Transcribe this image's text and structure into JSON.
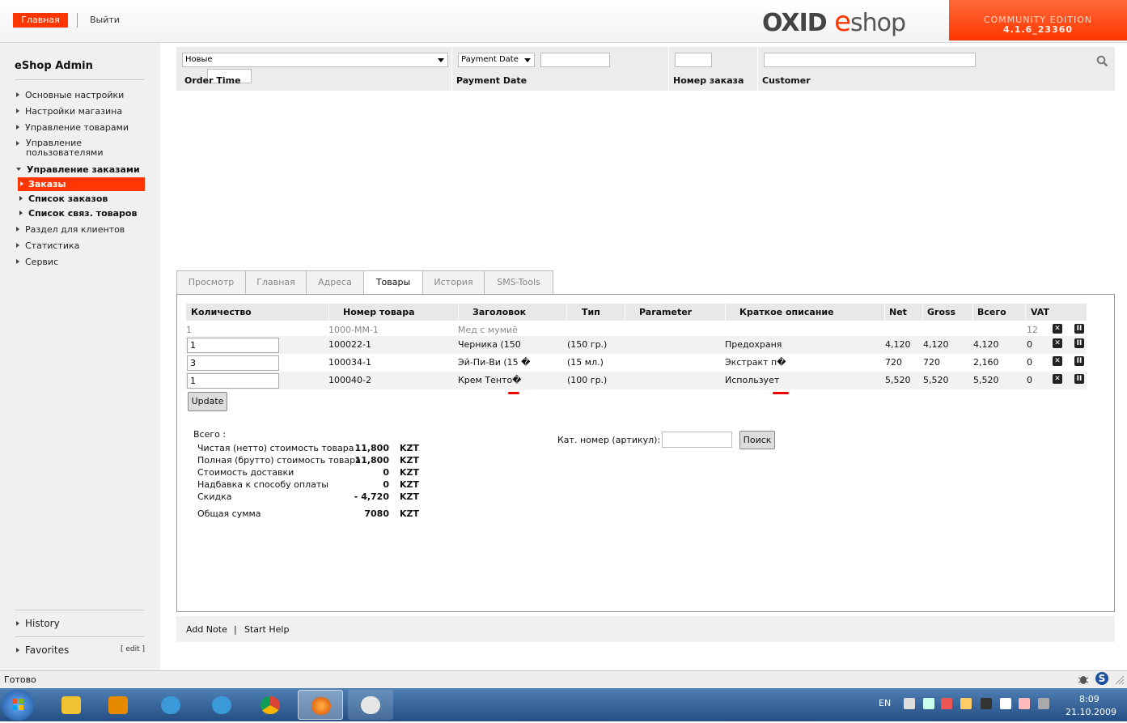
{
  "header": {
    "home_label": "Главная",
    "logout_label": "Выйти",
    "logo_oxid": "OXID",
    "logo_e": "e",
    "logo_shop": "shop",
    "edition_line1": "COMMUNITY EDITION",
    "edition_line2": "4.1.6_23360"
  },
  "sidebar": {
    "title": "eShop Admin",
    "items": [
      {
        "label": "Основные настройки"
      },
      {
        "label": "Настройки магазина"
      },
      {
        "label": "Управление товарами"
      },
      {
        "label": "Управление пользователями"
      },
      {
        "label": "Управление заказами"
      },
      {
        "label": "Раздел для клиентов"
      },
      {
        "label": "Статистика"
      },
      {
        "label": "Сервис"
      }
    ],
    "subitems": [
      {
        "label": "Заказы"
      },
      {
        "label": "Список заказов"
      },
      {
        "label": "Список связ. товаров"
      }
    ],
    "history_label": "History",
    "favorites_label": "Favorites",
    "edit_label": "[ edit ]"
  },
  "filter": {
    "status_value": "Новые",
    "order_time_label": "Order Time",
    "payment_select_value": "Payment Date",
    "payment_date_label": "Payment Date",
    "order_number_label": "Номер заказа",
    "customer_label": "Customer"
  },
  "tabs": [
    {
      "label": "Просмотр"
    },
    {
      "label": "Главная"
    },
    {
      "label": "Адреса"
    },
    {
      "label": "Товары"
    },
    {
      "label": "История"
    },
    {
      "label": "SMS-Tools"
    }
  ],
  "table": {
    "headers": [
      "Количество",
      "Номер товара",
      "Заголовок",
      "Тип",
      "Parameter",
      "Краткое описание",
      "Net",
      "Gross",
      "Всего",
      "VAT"
    ],
    "rows": [
      {
        "qty": "1",
        "number": "1000-MM-1",
        "title": "Мед с мумиё",
        "type": "",
        "param": "",
        "desc": "",
        "net": "",
        "gross": "",
        "total": "",
        "vat": "12"
      },
      {
        "qty": "1",
        "number": "100022-1",
        "title": "Черника (150",
        "type": "(150 гр.)",
        "param": "",
        "desc": "Предохраня",
        "net": "4,120",
        "gross": "4,120",
        "total": "4,120",
        "vat": "0"
      },
      {
        "qty": "3",
        "number": "100034-1",
        "title": "Эй-Пи-Ви (15 �",
        "type": "(15 мл.)",
        "param": "",
        "desc": "Экстракт п�",
        "net": "720",
        "gross": "720",
        "total": "2,160",
        "vat": "0"
      },
      {
        "qty": "1",
        "number": "100040-2",
        "title": "Крем Тенто�",
        "type": "(100 гр.)",
        "param": "",
        "desc": "Использует",
        "net": "5,520",
        "gross": "5,520",
        "total": "5,520",
        "vat": "0"
      }
    ],
    "update_label": "Update"
  },
  "summary": {
    "title": "Всего :",
    "lines": [
      {
        "label": "Чистая (нетто) стоимость товара",
        "value": "11,800",
        "currency": "KZT"
      },
      {
        "label": "Полная (брутто) стоимость товара",
        "value": "11,800",
        "currency": "KZT"
      },
      {
        "label": "Стоимость доставки",
        "value": "0",
        "currency": "KZT"
      },
      {
        "label": "Надбавка к способу оплаты",
        "value": "0",
        "currency": "KZT"
      },
      {
        "label": "Скидка",
        "value": "- 4,720",
        "currency": "KZT"
      },
      {
        "label": "Общая сумма",
        "value": "7080",
        "currency": "KZT"
      }
    ]
  },
  "article_search": {
    "label": "Кат. номер (артикул):",
    "button": "Поиск"
  },
  "notes": {
    "add_note": "Add Note",
    "separator": "|",
    "start_help": "Start Help"
  },
  "status": {
    "text": "Готово"
  },
  "taskbar": {
    "lang": "EN",
    "time": "8:09",
    "date": "21.10.2009"
  },
  "colors": {
    "accent": "#ff3600",
    "sidebar_bg": "#f0f0f0",
    "header_bg": "#e8e8e8"
  }
}
